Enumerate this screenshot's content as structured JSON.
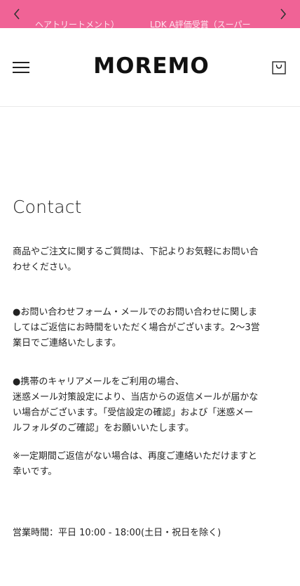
{
  "announcement": {
    "background": "#f06396",
    "items": [
      "ヘアトリートメント）",
      "LDK A評価受賞（スーパー"
    ],
    "prev_icon": "chevron-left-icon",
    "next_icon": "chevron-right-icon"
  },
  "header": {
    "logo_text": "MOREMO",
    "menu_icon": "hamburger-menu-icon",
    "cart_icon": "shopping-bag-icon"
  },
  "page": {
    "title": "Contact",
    "paragraphs": [
      [
        "商品やご注文に関するご質問は、下記よりお気軽にお問い合",
        "わせください。"
      ],
      [
        "●お問い合わせフォーム・メールでのお問い合わせに関しま",
        "してはご返信にお時間をいただく場合がございます。2〜3営",
        "業日でご連絡いたします。"
      ],
      [
        "●携帯のキャリアメールをご利用の場合、",
        "迷惑メール対策設定により、当店からの返信メールが届かな",
        "い場合がございます。「受信設定の確認」および「迷惑メー",
        "ルフォルダのご確認」をお願いいたします。"
      ],
      [
        "※一定期間ご返信がない場合は、再度ご連絡いただけますと",
        "幸いです。"
      ],
      [
        "営業時間：平日 10:00 - 18:00(土日・祝日を除く)"
      ]
    ]
  }
}
